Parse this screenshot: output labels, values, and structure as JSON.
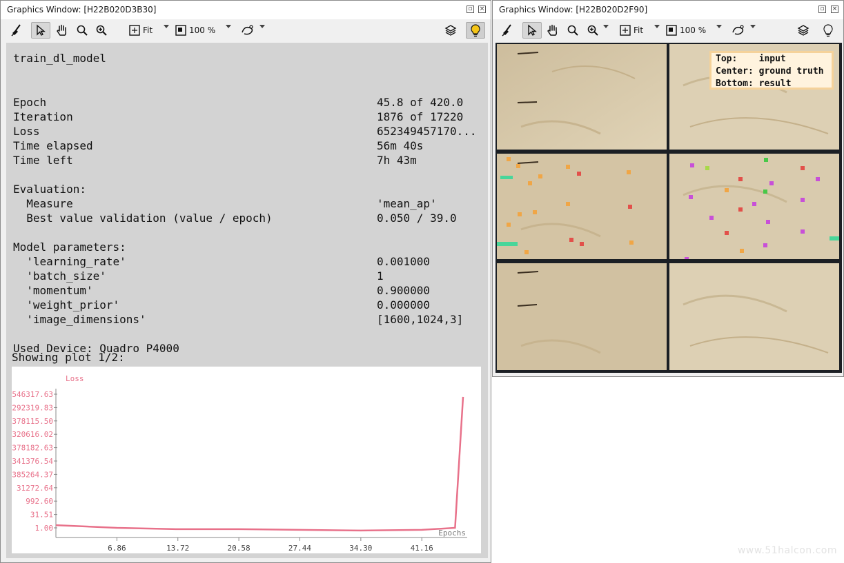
{
  "left_window": {
    "title": "Graphics Window: [H22B020D3B30]",
    "toolbar": {
      "zoom_mode": "Fit",
      "zoom_percent": "100 %"
    },
    "training": {
      "heading": "train_dl_model",
      "stats": [
        {
          "label": "Epoch",
          "value": "45.8 of 420.0"
        },
        {
          "label": "Iteration",
          "value": "1876 of 17220"
        },
        {
          "label": "Loss",
          "value": "652349457170..."
        },
        {
          "label": "Time elapsed",
          "value": "56m 40s"
        },
        {
          "label": "Time left",
          "value": "7h 43m"
        }
      ],
      "evaluation_heading": "Evaluation:",
      "evaluation": [
        {
          "label": "  Measure",
          "value": "'mean_ap'"
        },
        {
          "label": "  Best value validation (value / epoch)",
          "value": "0.050 / 39.0"
        }
      ],
      "params_heading": "Model parameters:",
      "params": [
        {
          "label": "  'learning_rate'",
          "value": "0.001000"
        },
        {
          "label": "  'batch_size'",
          "value": "1"
        },
        {
          "label": "  'momentum'",
          "value": "0.900000"
        },
        {
          "label": "  'weight_prior'",
          "value": "0.000000"
        },
        {
          "label": "  'image_dimensions'",
          "value": "[1600,1024,3]"
        }
      ],
      "device": "Used Device: Quadro P4000",
      "plot_caption": "Showing plot 1/2:"
    }
  },
  "chart_data": {
    "type": "line",
    "title": "",
    "ylabel": "Loss",
    "xlabel": "Epochs",
    "y_scale": "log",
    "y_tick_labels": [
      "546317.63",
      "292319.83",
      "378115.50",
      "320616.02",
      "378182.63",
      "341376.54",
      "385264.37",
      "31272.64",
      "992.60",
      "31.51",
      "1.00"
    ],
    "x_tick_labels": [
      "6.86",
      "13.72",
      "20.58",
      "27.44",
      "34.30",
      "41.16"
    ],
    "xlim": [
      0,
      45.8
    ],
    "series": [
      {
        "color": "#e8718a",
        "x": [
          0,
          6.86,
          13.72,
          20.58,
          27.44,
          34.3,
          41.16,
          44.9,
          45.8
        ],
        "y_tick_fraction": [
          0.02,
          0.0,
          -0.01,
          -0.01,
          -0.015,
          -0.02,
          -0.015,
          0.0,
          0.98
        ]
      }
    ]
  },
  "right_window": {
    "title": "Graphics Window: [H22B020D2F90]",
    "toolbar": {
      "zoom_mode": "Fit",
      "zoom_percent": "100 %"
    },
    "legend": {
      "lines": [
        "Top:    input",
        "Center: ground truth",
        "Bottom: result"
      ]
    }
  },
  "watermark": "www.51halcon.com",
  "colors": {
    "canvas_gray": "#d3d3d3",
    "loss_line": "#e8718a",
    "legend_bg": "#fff3de"
  }
}
